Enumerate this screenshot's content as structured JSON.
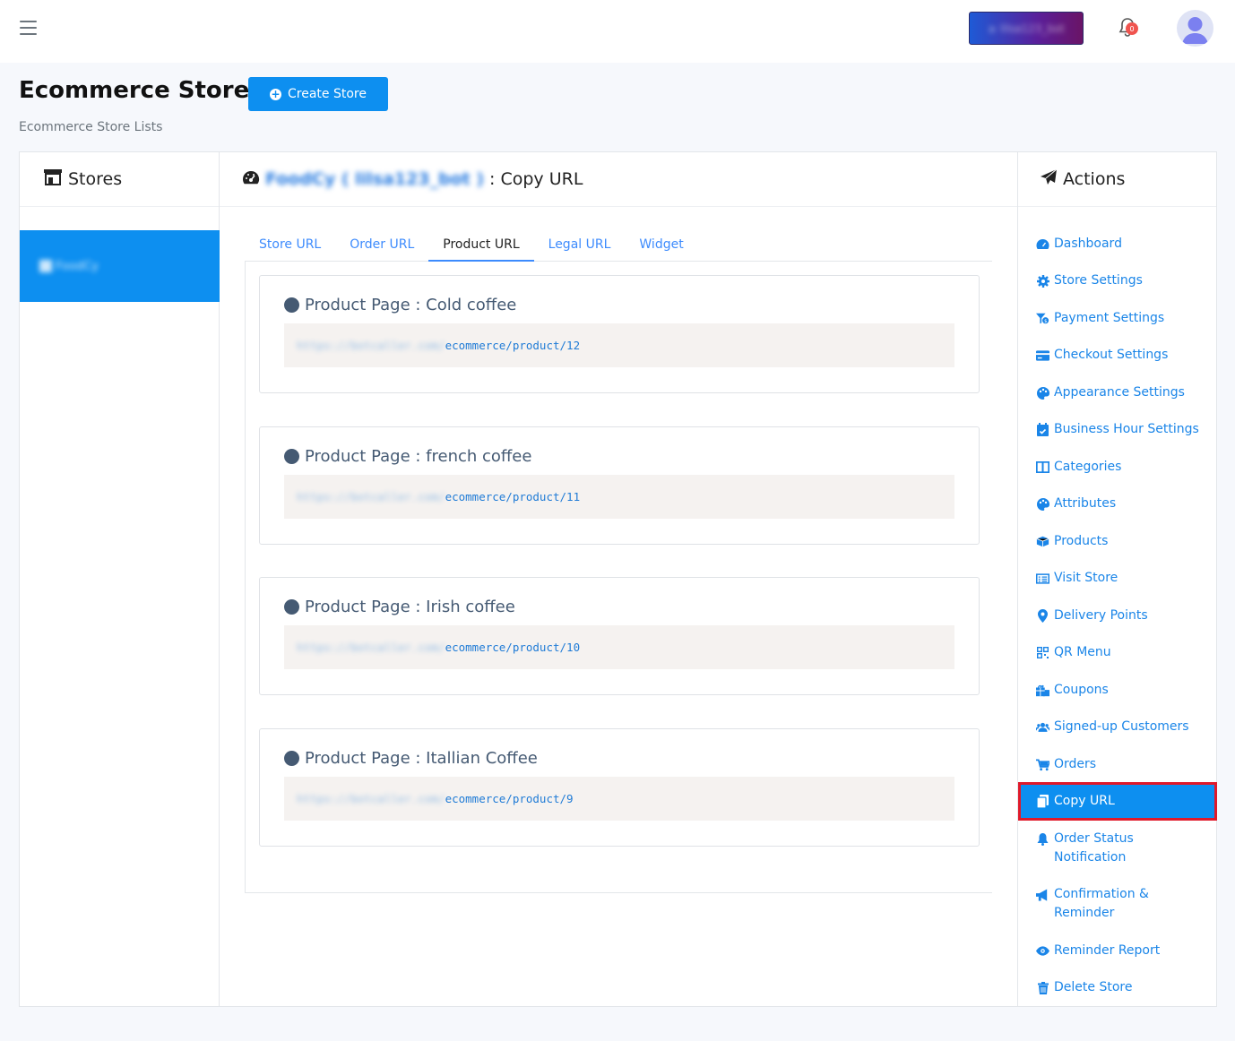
{
  "topbar": {
    "bot_button_label": "≥ lilsa123_bot",
    "notification_count": "0"
  },
  "header": {
    "title": "Ecommerce Store",
    "create_button": "Create Store",
    "subtitle": "Ecommerce Store Lists"
  },
  "stores_panel": {
    "title": "Stores",
    "items": [
      {
        "label": "FoodCy"
      }
    ]
  },
  "main": {
    "store_name": "FoodCy ( lilsa123_bot )",
    "section_title": ": Copy URL",
    "tabs": [
      {
        "label": "Store URL"
      },
      {
        "label": "Order URL"
      },
      {
        "label": "Product URL"
      },
      {
        "label": "Legal URL"
      },
      {
        "label": "Widget"
      }
    ],
    "active_tab": "Product URL",
    "products": [
      {
        "title": "Product Page : Cold coffee",
        "url_host": "https://botcaller.com/",
        "url_path": "ecommerce/product/12"
      },
      {
        "title": "Product Page : french coffee",
        "url_host": "https://botcaller.com/",
        "url_path": "ecommerce/product/11"
      },
      {
        "title": "Product Page : Irish coffee",
        "url_host": "https://botcaller.com/",
        "url_path": "ecommerce/product/10"
      },
      {
        "title": "Product Page : Itallian Coffee",
        "url_host": "https://botcaller.com/",
        "url_path": "ecommerce/product/9"
      }
    ]
  },
  "actions_panel": {
    "title": "Actions",
    "items": [
      {
        "label": "Dashboard",
        "icon": "dashboard-icon"
      },
      {
        "label": "Store Settings",
        "icon": "gear-icon"
      },
      {
        "label": "Payment Settings",
        "icon": "payment-icon"
      },
      {
        "label": "Checkout Settings",
        "icon": "credit-card-icon"
      },
      {
        "label": "Appearance Settings",
        "icon": "palette-icon"
      },
      {
        "label": "Business Hour Settings",
        "icon": "calendar-check-icon"
      },
      {
        "label": "Categories",
        "icon": "columns-icon"
      },
      {
        "label": "Attributes",
        "icon": "palette-icon"
      },
      {
        "label": "Products",
        "icon": "box-icon"
      },
      {
        "label": "Visit Store",
        "icon": "list-icon"
      },
      {
        "label": "Delivery Points",
        "icon": "map-pin-icon"
      },
      {
        "label": "QR Menu",
        "icon": "qrcode-icon"
      },
      {
        "label": "Coupons",
        "icon": "gift-icon"
      },
      {
        "label": "Signed-up Customers",
        "icon": "users-icon"
      },
      {
        "label": "Orders",
        "icon": "cart-icon"
      },
      {
        "label": "Copy URL",
        "icon": "copy-icon"
      },
      {
        "label": "Order Status Notification",
        "icon": "bell-icon"
      },
      {
        "label": "Confirmation & Reminder",
        "icon": "megaphone-icon"
      },
      {
        "label": "Reminder Report",
        "icon": "eye-icon"
      },
      {
        "label": "Delete Store",
        "icon": "trash-icon"
      }
    ],
    "selected": "Copy URL"
  },
  "colors": {
    "primary": "#0d8ff0",
    "link": "#1a85e8",
    "highlight_border": "#e0192a",
    "badge": "#f0544f"
  }
}
